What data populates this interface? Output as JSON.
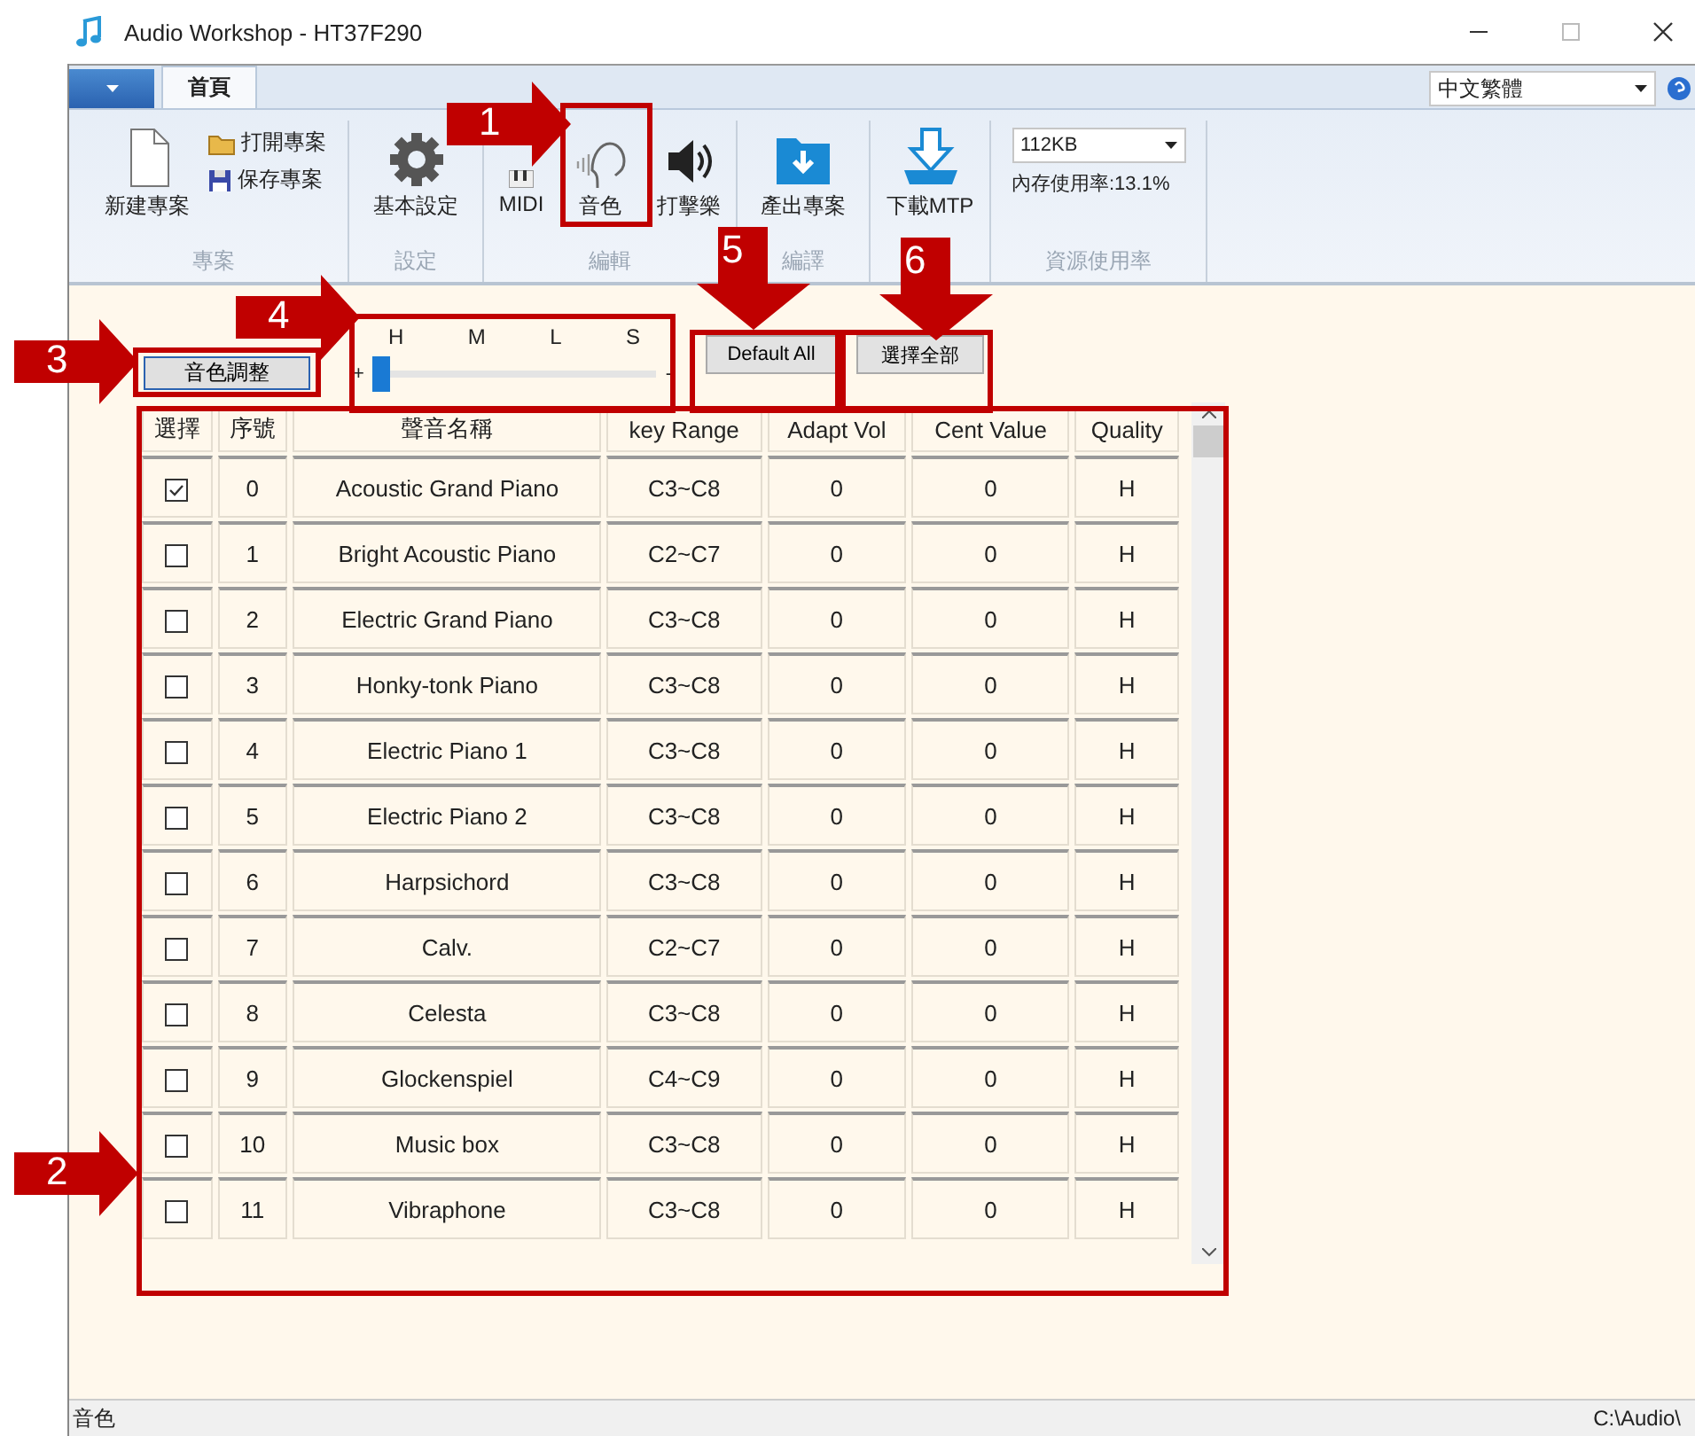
{
  "window": {
    "title": "Audio Workshop - HT37F290"
  },
  "ribbon": {
    "tabs": [
      {
        "label": "首頁",
        "selected": true
      }
    ],
    "language": "中文繁體",
    "groups": [
      {
        "label": "專案",
        "items": [
          {
            "kind": "large",
            "label": "新建專案"
          },
          {
            "kind": "small",
            "label": "打開專案"
          },
          {
            "kind": "small",
            "label": "保存專案"
          }
        ]
      },
      {
        "label": "設定",
        "items": [
          {
            "kind": "large",
            "label": "基本設定"
          }
        ]
      },
      {
        "label": "編輯",
        "items": [
          {
            "kind": "large",
            "label": "MIDI"
          },
          {
            "kind": "large",
            "label": "音色"
          },
          {
            "kind": "large",
            "label": "打擊樂"
          }
        ]
      },
      {
        "label": "編譯",
        "items": [
          {
            "kind": "large",
            "label": "產出專案"
          }
        ]
      },
      {
        "items": [
          {
            "kind": "large",
            "label": "下載MTP"
          }
        ]
      },
      {
        "label": "資源使用率",
        "items": [
          {
            "kind": "dropdown",
            "label": "112KB"
          },
          {
            "kind": "text",
            "label": "內存使用率:13.1%"
          }
        ]
      }
    ]
  },
  "toolbar": {
    "adjust_button": "音色調整",
    "quality_slider": {
      "labels": [
        "H",
        "M",
        "L",
        "S"
      ],
      "plus": "+",
      "minus": "-",
      "level": 0
    },
    "buttons": [
      "Default All",
      "選擇全部"
    ]
  },
  "table": {
    "columns": [
      "選擇",
      "序號",
      "聲音名稱",
      "key Range",
      "Adapt Vol",
      "Cent Value",
      "Quality"
    ],
    "rows": [
      {
        "checked": true,
        "cells": [
          "",
          "0",
          "Acoustic Grand Piano",
          "C3~C8",
          "0",
          "0",
          "H"
        ]
      },
      {
        "checked": false,
        "cells": [
          "",
          "1",
          "Bright Acoustic Piano",
          "C2~C7",
          "0",
          "0",
          "H"
        ]
      },
      {
        "checked": false,
        "cells": [
          "",
          "2",
          "Electric Grand Piano",
          "C3~C8",
          "0",
          "0",
          "H"
        ]
      },
      {
        "checked": false,
        "cells": [
          "",
          "3",
          "Honky-tonk Piano",
          "C3~C8",
          "0",
          "0",
          "H"
        ]
      },
      {
        "checked": false,
        "cells": [
          "",
          "4",
          "Electric Piano 1",
          "C3~C8",
          "0",
          "0",
          "H"
        ]
      },
      {
        "checked": false,
        "cells": [
          "",
          "5",
          "Electric Piano 2",
          "C3~C8",
          "0",
          "0",
          "H"
        ]
      },
      {
        "checked": false,
        "cells": [
          "",
          "6",
          "Harpsichord",
          "C3~C8",
          "0",
          "0",
          "H"
        ]
      },
      {
        "checked": false,
        "cells": [
          "",
          "7",
          "Calv.",
          "C2~C7",
          "0",
          "0",
          "H"
        ]
      },
      {
        "checked": false,
        "cells": [
          "",
          "8",
          "Celesta",
          "C3~C8",
          "0",
          "0",
          "H"
        ]
      },
      {
        "checked": false,
        "cells": [
          "",
          "9",
          "Glockenspiel",
          "C4~C9",
          "0",
          "0",
          "H"
        ]
      },
      {
        "checked": false,
        "cells": [
          "",
          "10",
          "Music box",
          "C3~C8",
          "0",
          "0",
          "H"
        ]
      },
      {
        "checked": false,
        "cells": [
          "",
          "11",
          "Vibraphone",
          "C3~C8",
          "0",
          "0",
          "H"
        ]
      }
    ]
  },
  "status_bar": {
    "left": "音色",
    "right": "C:\\Audio\\"
  },
  "callouts": [
    {
      "number": "1",
      "kind": "right"
    },
    {
      "number": "2",
      "kind": "right"
    },
    {
      "number": "3",
      "kind": "right"
    },
    {
      "number": "4",
      "kind": "right"
    },
    {
      "number": "5",
      "kind": "down"
    },
    {
      "number": "6",
      "kind": "down"
    }
  ]
}
